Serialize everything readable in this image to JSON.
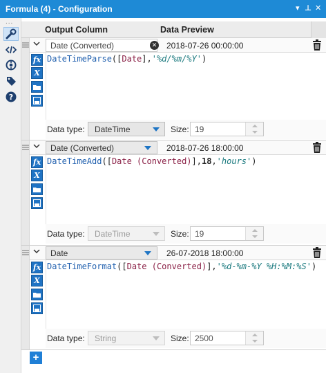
{
  "window": {
    "title": "Formula (4) - Configuration",
    "menu_glyph": "▾",
    "pin_glyph": "⊥",
    "close_glyph": "✕"
  },
  "sidebar": {
    "grip": "...",
    "items": [
      {
        "name": "configuration-icon",
        "active": true
      },
      {
        "name": "code-icon",
        "active": false
      },
      {
        "name": "layout-icon",
        "active": false
      },
      {
        "name": "tag-icon",
        "active": false
      },
      {
        "name": "help-icon",
        "active": false
      }
    ]
  },
  "header": {
    "output_column": "Output Column",
    "data_preview": "Data Preview"
  },
  "labels": {
    "data_type": "Data type:",
    "size": "Size:"
  },
  "tool_glyphs": {
    "fx": "fx",
    "variable": "X"
  },
  "formulas": [
    {
      "output_column": "Date (Converted)",
      "output_mode": "new-field",
      "preview": "2018-07-26 00:00:00",
      "expression": {
        "fn": "DateTimeParse",
        "open": "([",
        "field": "Date",
        "mid": "],",
        "arg": "'%d/%m/%Y'",
        "close": ")"
      },
      "data_type": "DateTime",
      "data_type_disabled": false,
      "size": "19"
    },
    {
      "output_column": "Date (Converted)",
      "output_mode": "existing-field",
      "preview": "2018-07-26 18:00:00",
      "expression": {
        "fn": "DateTimeAdd",
        "open": "([",
        "field": "Date (Converted)",
        "mid": "],",
        "num": "18",
        "comma": ",",
        "arg": "'hours'",
        "close": ")"
      },
      "data_type": "DateTime",
      "data_type_disabled": true,
      "size": "19"
    },
    {
      "output_column": "Date",
      "output_mode": "existing-field",
      "preview": "26-07-2018 18:00:00",
      "expression": {
        "fn": "DateTimeFormat",
        "open": "([",
        "field": "Date (Converted)",
        "mid": "],",
        "arg": "'%d-%m-%Y %H:%M:%S'",
        "close": ")"
      },
      "data_type": "String",
      "data_type_disabled": true,
      "size": "2500"
    }
  ],
  "add_button": "+",
  "colors": {
    "titlebar": "#1e8ad6",
    "accent": "#1f73c4",
    "function": "#1f5fae",
    "field": "#8a2046",
    "string": "#1c7a7f"
  }
}
